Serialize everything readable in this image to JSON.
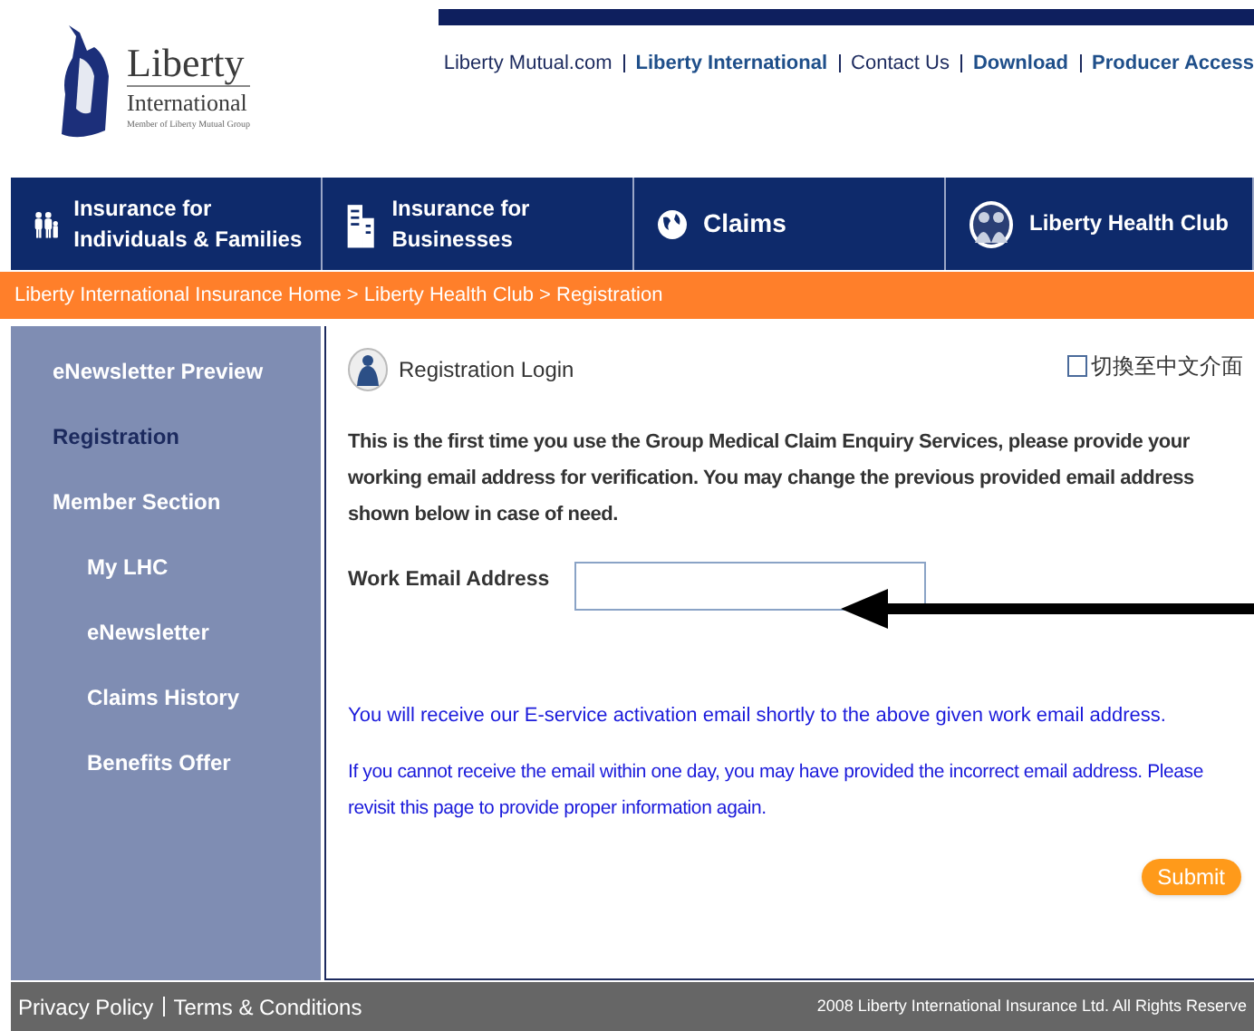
{
  "logo": {
    "name": "Liberty",
    "subtitle": "International",
    "tagline": "Member of Liberty Mutual Group"
  },
  "top_links": [
    {
      "label": "Liberty Mutual.com",
      "bold": false
    },
    {
      "label": "Liberty International",
      "bold": true
    },
    {
      "label": "Contact Us",
      "bold": false
    },
    {
      "label": "Download",
      "bold": true
    },
    {
      "label": "Producer Access",
      "bold": true
    }
  ],
  "nav": [
    {
      "kind": "family",
      "label": "Insurance for Individuals & Families"
    },
    {
      "kind": "building",
      "label": "Insurance for Businesses"
    },
    {
      "kind": "globe",
      "label": "Claims"
    },
    {
      "kind": "club",
      "label": "Liberty Health Club"
    }
  ],
  "breadcrumb": "Liberty International Insurance Home > Liberty Health Club > Registration",
  "sidebar": {
    "items": [
      {
        "label": "eNewsletter Preview",
        "selected": false
      },
      {
        "label": "Registration",
        "selected": true
      },
      {
        "label": "Member Section",
        "selected": false,
        "children": [
          {
            "label": "My LHC",
            "selected": false
          },
          {
            "label": "eNewsletter",
            "selected": false
          },
          {
            "label": "Claims History",
            "selected": false
          },
          {
            "label": "Benefits Offer",
            "selected": false
          }
        ]
      }
    ]
  },
  "content": {
    "title": "Registration Login",
    "language_toggle": {
      "label": "切換至中文介面",
      "checked": false
    },
    "intro": "This is the first time you use the Group Medical Claim Enquiry Services, please provide your working email address for verification. You may change the previous provided email address shown below in case of need.",
    "email_field": {
      "label": "Work Email Address"
    },
    "notes": [
      "You will receive our E-service activation email shortly to the above given work email address.",
      "If you cannot receive the email within one day, you may have provided the incorrect email address. Please revisit this page to provide proper information again."
    ],
    "submit": "Submit"
  },
  "footer": {
    "links": [
      "Privacy Policy",
      "Terms & Conditions"
    ],
    "copyright": "2008 Liberty International Insurance Ltd. All Rights Reserve"
  }
}
